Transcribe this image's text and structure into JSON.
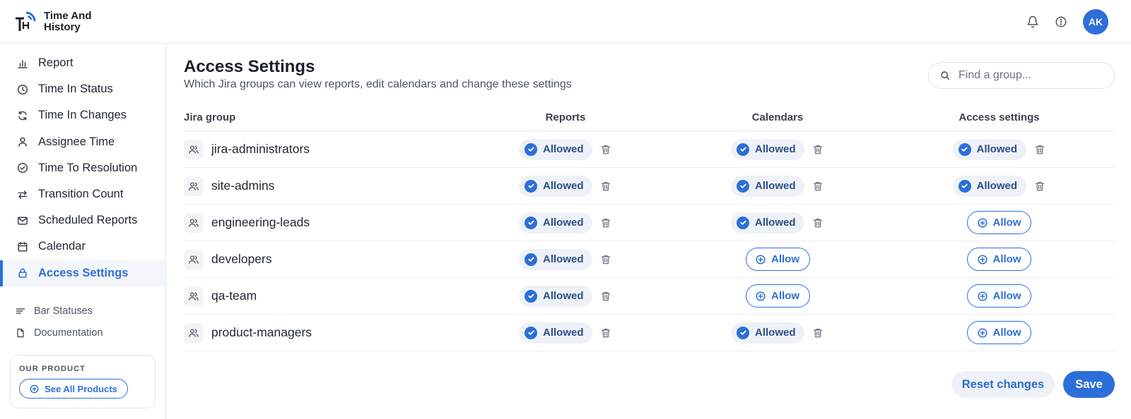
{
  "brand": {
    "name_line1": "Time And",
    "name_line2": "History",
    "logo_letters": "TH"
  },
  "header": {
    "avatar_initials": "AK"
  },
  "sidebar": {
    "items": [
      {
        "label": "Report",
        "icon": "bar-chart-icon"
      },
      {
        "label": "Time In Status",
        "icon": "clock-icon"
      },
      {
        "label": "Time In Changes",
        "icon": "refresh-icon"
      },
      {
        "label": "Assignee Time",
        "icon": "user-icon"
      },
      {
        "label": "Time To Resolution",
        "icon": "check-circle-icon"
      },
      {
        "label": "Transition Count",
        "icon": "arrows-swap-icon"
      },
      {
        "label": "Scheduled Reports",
        "icon": "mail-icon"
      },
      {
        "label": "Calendar",
        "icon": "calendar-icon"
      },
      {
        "label": "Access Settings",
        "icon": "lock-icon",
        "active": true
      }
    ],
    "sub_links": [
      {
        "label": "Bar Statuses",
        "icon": "lines-icon"
      },
      {
        "label": "Documentation",
        "icon": "document-icon"
      }
    ],
    "product_card": {
      "kicker": "OUR PRODUCT",
      "button_label": "See All Products"
    }
  },
  "main": {
    "title": "Access Settings",
    "subtitle": "Which Jira groups can view reports, edit calendars and change these settings",
    "search": {
      "placeholder": "Find a group..."
    },
    "table": {
      "headers": [
        "Jira group",
        "Reports",
        "Calendars",
        "Access settings"
      ],
      "allowed_label": "Allowed",
      "allow_label": "Allow",
      "rows": [
        {
          "group": "jira-administrators",
          "reports": true,
          "calendars": true,
          "access": true
        },
        {
          "group": "site-admins",
          "reports": true,
          "calendars": true,
          "access": true
        },
        {
          "group": "engineering-leads",
          "reports": true,
          "calendars": true,
          "access": false
        },
        {
          "group": "developers",
          "reports": true,
          "calendars": false,
          "access": false
        },
        {
          "group": "qa-team",
          "reports": true,
          "calendars": false,
          "access": false
        },
        {
          "group": "product-managers",
          "reports": true,
          "calendars": true,
          "access": false
        }
      ]
    },
    "actions": {
      "reset_label": "Reset changes",
      "save_label": "Save"
    }
  },
  "colors": {
    "accent": "#2d6fd9",
    "allowed_bg": "#eef2f8",
    "allowed_text": "#2c4f86"
  }
}
